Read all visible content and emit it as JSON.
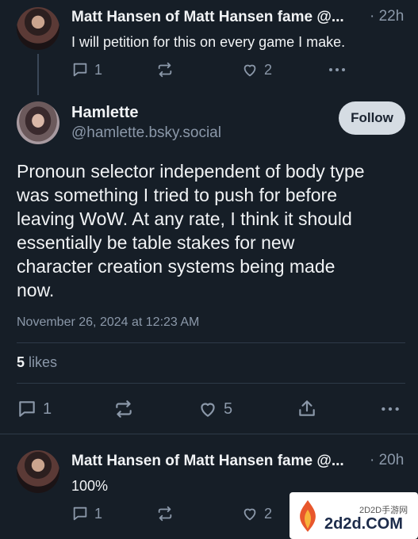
{
  "posts": {
    "parent": {
      "author": "Matt Hansen of Matt Hansen fame @...",
      "time": "· 22h",
      "text": "I will petition for this on every game I make.",
      "reply_count": "1",
      "like_count": "2"
    },
    "main": {
      "display_name": "Hamlette",
      "handle": "@hamlette.bsky.social",
      "follow_label": "Follow",
      "text_lines": [
        "Pronoun selector independent of body type",
        "was something I tried to push for before",
        "leaving WoW. At any rate, I think it should",
        "essentially be table stakes for new",
        "character creation systems being made",
        "now."
      ],
      "timestamp": "November 26, 2024 at 12:23 AM",
      "likes_count": "5",
      "likes_label": "likes",
      "reply_count": "1",
      "like_count": "5"
    },
    "reply": {
      "author": "Matt Hansen of Matt Hansen fame @...",
      "time": "· 20h",
      "text": "100%",
      "reply_count": "1",
      "like_count": "2"
    }
  },
  "watermark": {
    "cn_text": "2D2D手游网",
    "domain_text": "2d2d.COM"
  },
  "colors": {
    "background": "#161e27",
    "text": "#f1f3f5",
    "muted": "#8b98a9",
    "follow_bg": "#d5dce3"
  },
  "icons": [
    "reply-icon",
    "repost-icon",
    "like-icon",
    "more-icon",
    "share-icon"
  ]
}
